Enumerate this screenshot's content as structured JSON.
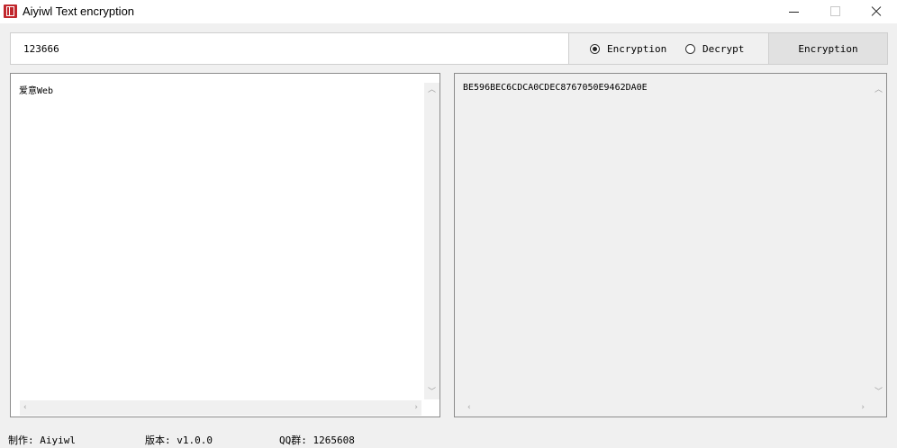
{
  "window": {
    "title": "Aiyiwl Text encryption"
  },
  "key": {
    "value": "123666"
  },
  "mode": {
    "encrypt_label": "Encryption",
    "decrypt_label": "Decrypt",
    "selected": "encrypt"
  },
  "action": {
    "label": "Encryption"
  },
  "input_panel": {
    "text": "爱意Web"
  },
  "output_panel": {
    "text": "BE596BEC6CDCA0CDEC8767050E9462DA0E"
  },
  "status": {
    "author": "制作: Aiyiwl",
    "version": "版本: v1.0.0",
    "qq_group": "QQ群: 1265608"
  },
  "icons": {
    "app": "app-logo-icon",
    "minimize": "minimize-icon",
    "maximize": "maximize-icon",
    "close": "close-icon"
  },
  "colors": {
    "app_icon": "#c1272d",
    "window_bg": "#f0f0f0"
  }
}
